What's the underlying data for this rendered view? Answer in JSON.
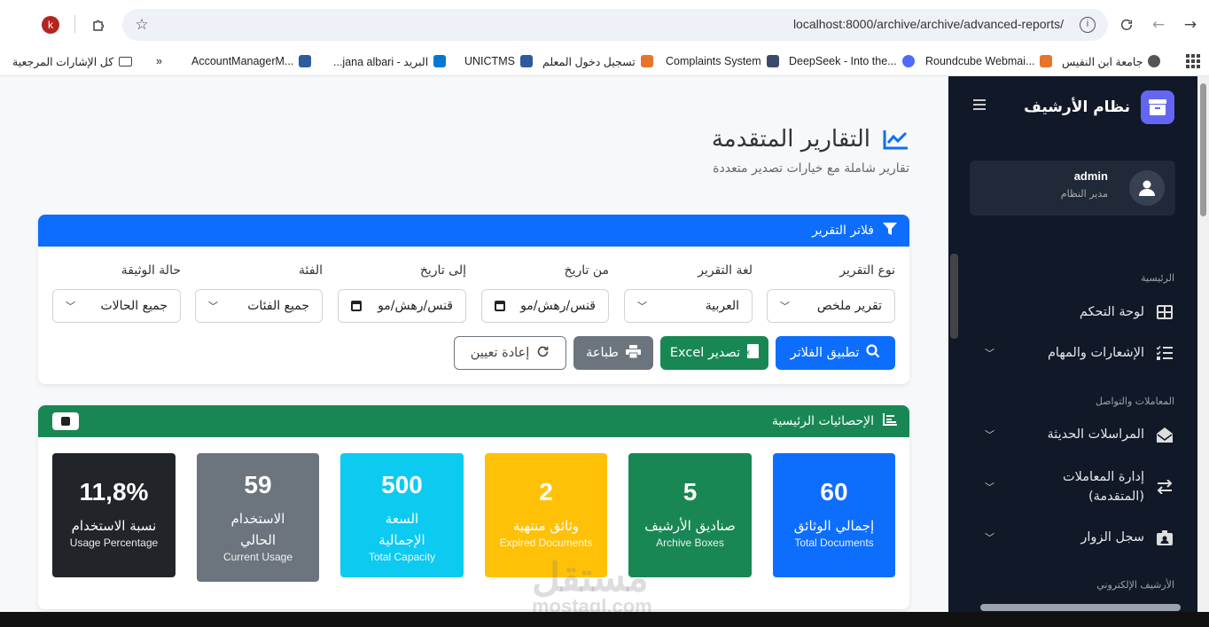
{
  "browser": {
    "profile_initial": "k",
    "url": "localhost:8000/archive/archive/advanced-reports/",
    "bookmarks": [
      {
        "label": "جامعة ابن النفيس",
        "color": "#555"
      },
      {
        "label": "Roundcube Webmai...",
        "color": "#e8742a"
      },
      {
        "label": "DeepSeek - Into the...",
        "color": "#4d6bfe"
      },
      {
        "label": "Complaints System",
        "color": "#3b4a6b"
      },
      {
        "label": "تسجيل دخول المعلم",
        "color": "#e8742a"
      },
      {
        "label": "UNICTMS",
        "color": "#2d5b9c"
      },
      {
        "label": "البريد - jana albari...",
        "color": "#0078d4"
      },
      {
        "label": "AccountManagerM...",
        "color": "#2d5b9c"
      }
    ],
    "bookmarks_folder": "كل الإشارات المرجعية"
  },
  "page": {
    "title": "التقارير المتقدمة",
    "subtitle": "تقارير شاملة مع خيارات تصدير متعددة"
  },
  "filters": {
    "header": "فلاتر التقرير",
    "report_type_label": "نوع التقرير",
    "report_type_value": "تقرير ملخص",
    "report_lang_label": "لغة التقرير",
    "report_lang_value": "العربية",
    "from_label": "من تاريخ",
    "from_value": "قنس/رهش/مو",
    "to_label": "إلى تاريخ",
    "to_value": "قنس/رهش/مو",
    "category_label": "الفئة",
    "category_value": "جميع الفئات",
    "status_label": "حالة الوثيقة",
    "status_value": "جميع الحالات",
    "apply_button": "تطبيق الفلاتر",
    "excel_button": "تصدير Excel",
    "print_button": "طباعة",
    "reset_button": "إعادة تعيين"
  },
  "stats": {
    "header": "الإحصائيات الرئيسية",
    "cards": [
      {
        "value": "60",
        "ar": "إجمالي الوثائق",
        "en": "Total Documents",
        "color": "#0d6efd"
      },
      {
        "value": "5",
        "ar": "صناديق الأرشيف",
        "en": "Archive Boxes",
        "color": "#198754"
      },
      {
        "value": "2",
        "ar": "وثائق منتهية",
        "en": "Expired Documents",
        "color": "#ffc107"
      },
      {
        "value": "500",
        "ar": "السعة الإجمالية",
        "en": "Total Capacity",
        "color": "#0dcaf0"
      },
      {
        "value": "59",
        "ar": "الاستخدام الحالي",
        "en": "Current Usage",
        "color": "#6c757d"
      },
      {
        "value": "11,8%",
        "ar": "نسبة الاستخدام",
        "en": "Usage Percentage",
        "color": "#212529"
      }
    ]
  },
  "sidebar": {
    "brand": "نظام الأرشيف",
    "user_name": "admin",
    "user_role": "مدير النظام",
    "section_home": "الرئيسية",
    "item_dashboard": "لوحة التحكم",
    "item_notifications": "الإشعارات والمهام",
    "section_transactions": "المعاملات والتواصل",
    "item_correspondence": "المراسلات الحديثة",
    "item_transactions": "إدارة المعاملات (المتقدمة)",
    "item_visitors": "سجل الزوار",
    "section_earchive": "الأرشيف الإلكتروني"
  },
  "watermark": {
    "ar": "مستقل",
    "en": "mostaql.com"
  }
}
